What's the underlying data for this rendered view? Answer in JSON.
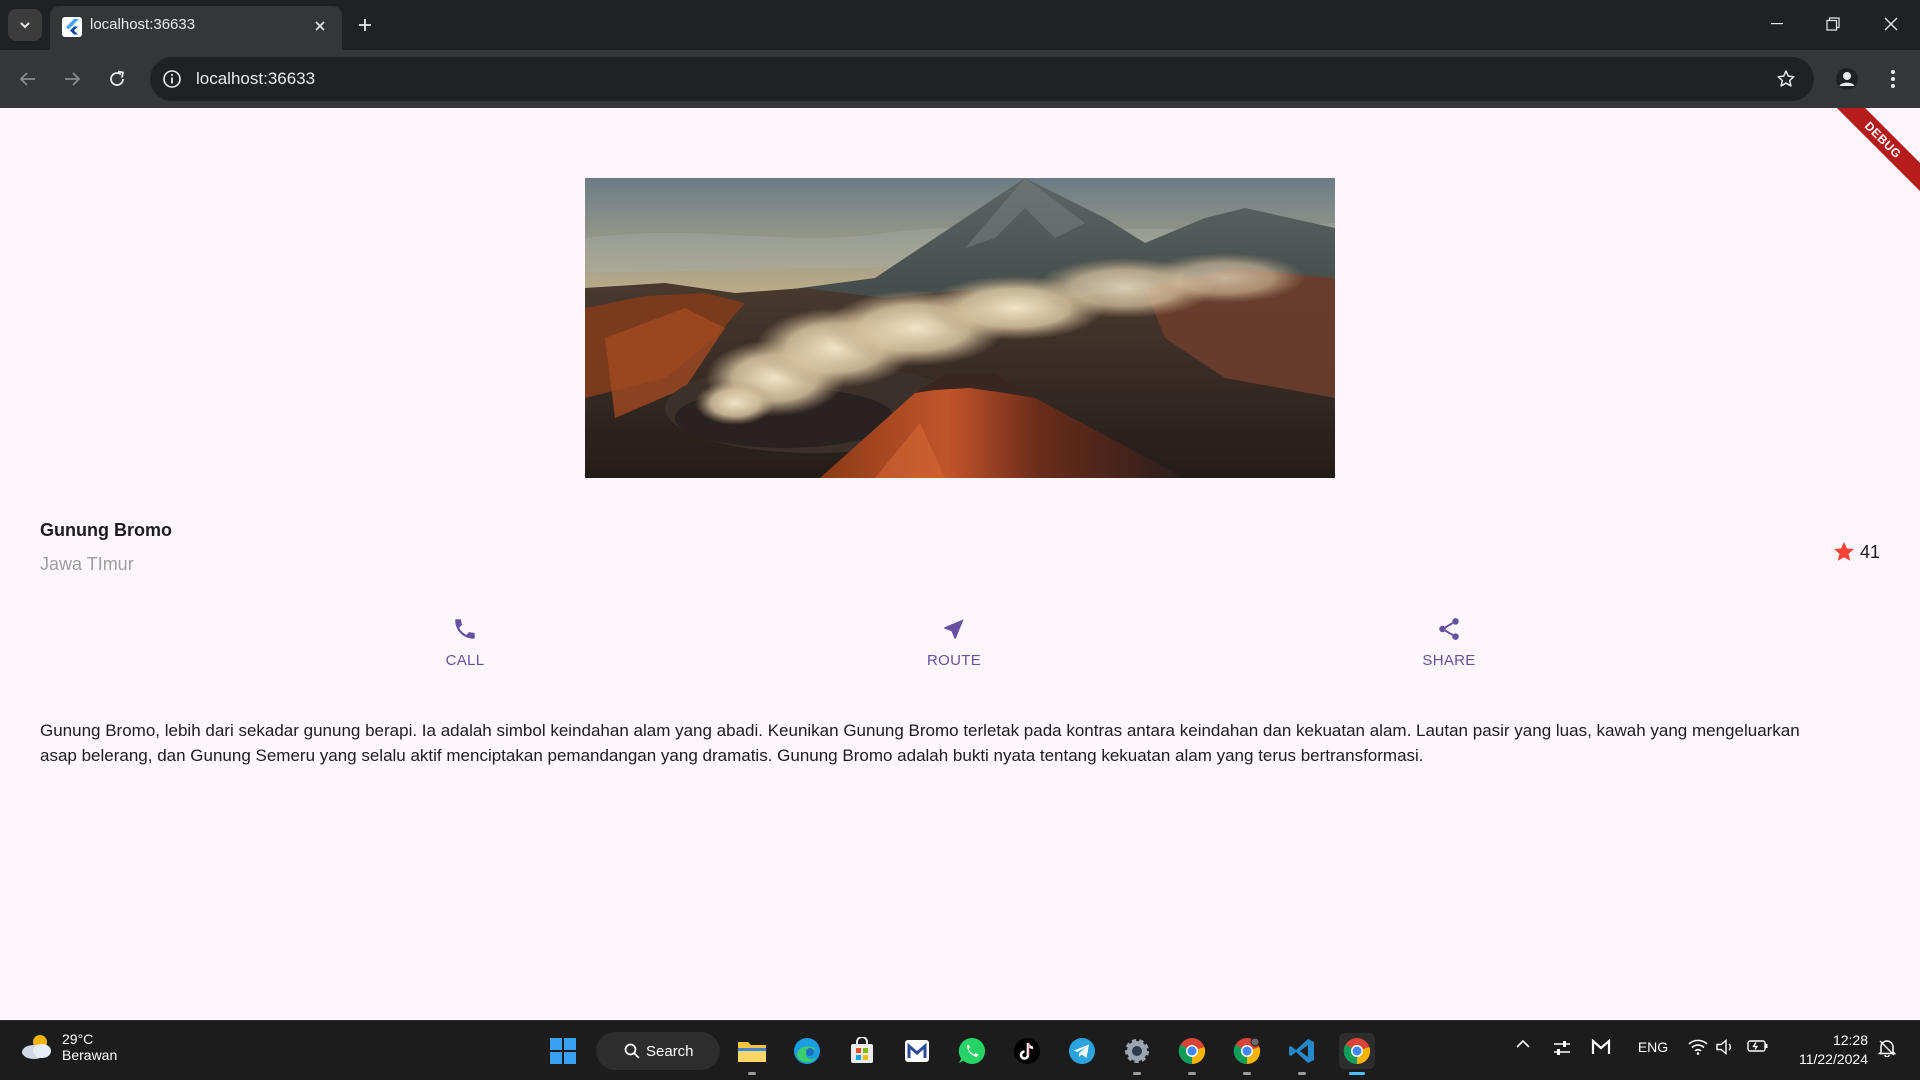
{
  "browser": {
    "tab_title": "localhost:36633",
    "url": "localhost:36633"
  },
  "app": {
    "debug_banner": "DEBUG",
    "place_name": "Gunung Bromo",
    "place_region": "Jawa TImur",
    "rating_count": "41",
    "rating_color": "#f44336",
    "accent_color": "#6750a4",
    "actions": [
      {
        "label": "CALL",
        "icon": "phone-icon"
      },
      {
        "label": "ROUTE",
        "icon": "navigation-icon"
      },
      {
        "label": "SHARE",
        "icon": "share-icon"
      }
    ],
    "description": "Gunung Bromo, lebih dari sekadar gunung berapi. Ia adalah simbol keindahan alam yang abadi. Keunikan Gunung Bromo terletak pada kontras antara keindahan dan kekuatan alam. Lautan pasir yang luas, kawah yang mengeluarkan asap belerang, dan Gunung Semeru yang selalu aktif menciptakan pemandangan yang dramatis. Gunung Bromo adalah bukti nyata tentang kekuatan alam yang terus bertransformasi."
  },
  "taskbar": {
    "weather_temp": "29°C",
    "weather_desc": "Berawan",
    "search_label": "Search",
    "language": "ENG",
    "time": "12:28",
    "date": "11/22/2024",
    "apps": [
      "start-icon",
      "file-explorer-icon",
      "edge-icon",
      "store-icon",
      "gmail-icon",
      "whatsapp-icon",
      "tiktok-icon",
      "telegram-icon",
      "settings-icon",
      "chrome-icon",
      "chrome-profile-icon",
      "vscode-icon",
      "chrome-active-icon"
    ]
  }
}
